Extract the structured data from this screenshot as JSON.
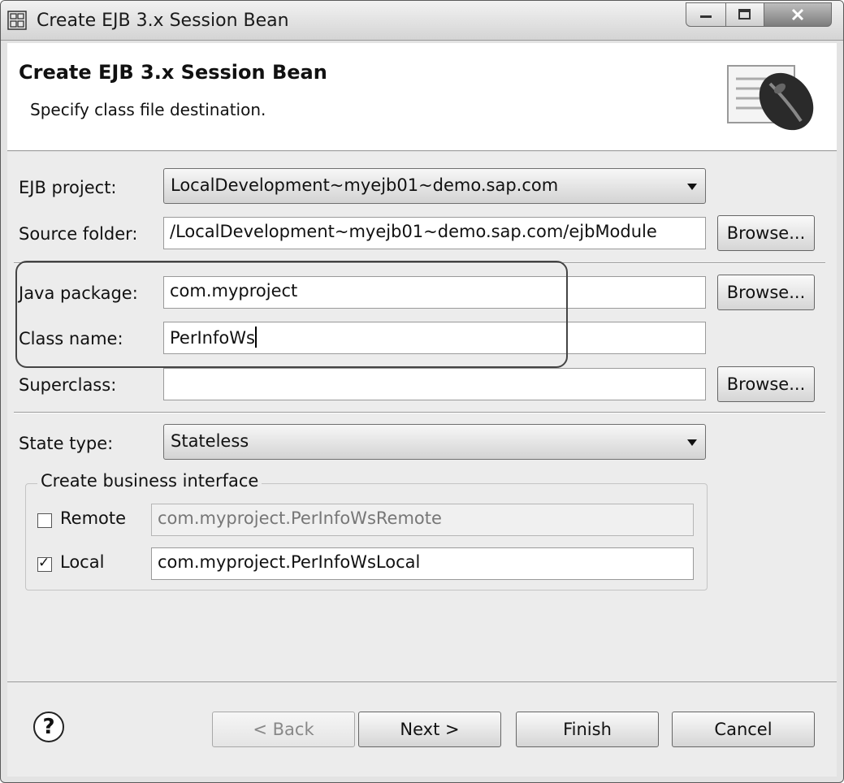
{
  "window": {
    "title": "Create EJB 3.x Session Bean"
  },
  "banner": {
    "heading": "Create EJB 3.x Session Bean",
    "subtitle": "Specify class file destination."
  },
  "form": {
    "ejb_project": {
      "label": "EJB project:",
      "value": "LocalDevelopment~myejb01~demo.sap.com"
    },
    "source_folder": {
      "label": "Source folder:",
      "value": "/LocalDevelopment~myejb01~demo.sap.com/ejbModule",
      "browse": "Browse..."
    },
    "java_package": {
      "label": "Java package:",
      "value": "com.myproject",
      "browse": "Browse..."
    },
    "class_name": {
      "label": "Class name:",
      "value": "PerInfoWs"
    },
    "superclass": {
      "label": "Superclass:",
      "value": "",
      "browse": "Browse..."
    },
    "state_type": {
      "label": "State type:",
      "value": "Stateless"
    },
    "business_interface": {
      "title": "Create business interface",
      "remote": {
        "label": "Remote",
        "checked": false,
        "value": "com.myproject.PerInfoWsRemote"
      },
      "local": {
        "label": "Local",
        "checked": true,
        "value": "com.myproject.PerInfoWsLocal"
      }
    }
  },
  "footer": {
    "help": "?",
    "back": "< Back",
    "next": "Next >",
    "finish": "Finish",
    "cancel": "Cancel"
  }
}
